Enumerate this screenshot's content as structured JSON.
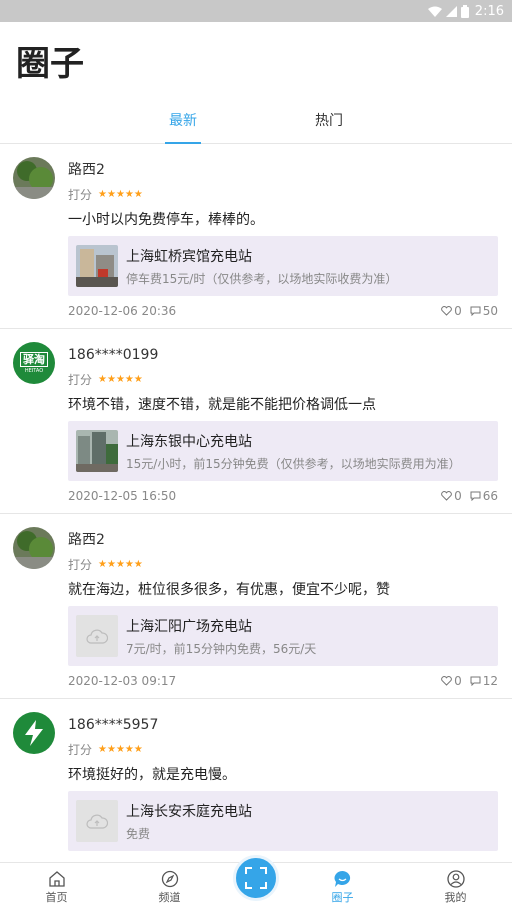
{
  "status_bar": {
    "time": "2:16"
  },
  "page": {
    "title": "圈子"
  },
  "tabs": [
    {
      "label": "最新",
      "active": true
    },
    {
      "label": "热门",
      "active": false
    }
  ],
  "posts": [
    {
      "user": "路西2",
      "rating_label": "打分",
      "stars": "★★★★★",
      "text": "一小时以内免费停车，棒棒的。",
      "station": {
        "name": "上海虹桥宾馆充电站",
        "price": "停车费15元/时（仅供参考，以场地实际收费为准）"
      },
      "time": "2020-12-06 20:36",
      "likes": "0",
      "comments": "50"
    },
    {
      "user": "186****0199",
      "rating_label": "打分",
      "stars": "★★★★★",
      "text": "环境不错，速度不错，就是能不能把价格调低一点",
      "station": {
        "name": "上海东银中心充电站",
        "price": "15元/小时，前15分钟免费（仅供参考，以场地实际费用为准）"
      },
      "time": "2020-12-05 16:50",
      "likes": "0",
      "comments": "66",
      "avatar_text": "驿淘",
      "avatar_sub": "HEITAO"
    },
    {
      "user": "路西2",
      "rating_label": "打分",
      "stars": "★★★★★",
      "text": "就在海边，桩位很多很多，有优惠，便宜不少呢，赞",
      "station": {
        "name": "上海汇阳广场充电站",
        "price": "7元/时，前15分钟内免费，56元/天"
      },
      "time": "2020-12-03 09:17",
      "likes": "0",
      "comments": "12"
    },
    {
      "user": "186****5957",
      "rating_label": "打分",
      "stars": "★★★★★",
      "text": "环境挺好的，就是充电慢。",
      "station": {
        "name": "上海长安禾庭充电站",
        "price": "免费"
      }
    }
  ],
  "bottom_nav": [
    {
      "label": "首页",
      "icon": "home-icon"
    },
    {
      "label": "频道",
      "icon": "compass-icon"
    },
    {
      "label": "圈子",
      "icon": "chat-bubble-icon",
      "active": true
    },
    {
      "label": "我的",
      "icon": "user-icon"
    }
  ],
  "colors": {
    "accent": "#35a5e8",
    "star": "#ff9f1a",
    "card_bg": "#eeeaf5"
  }
}
